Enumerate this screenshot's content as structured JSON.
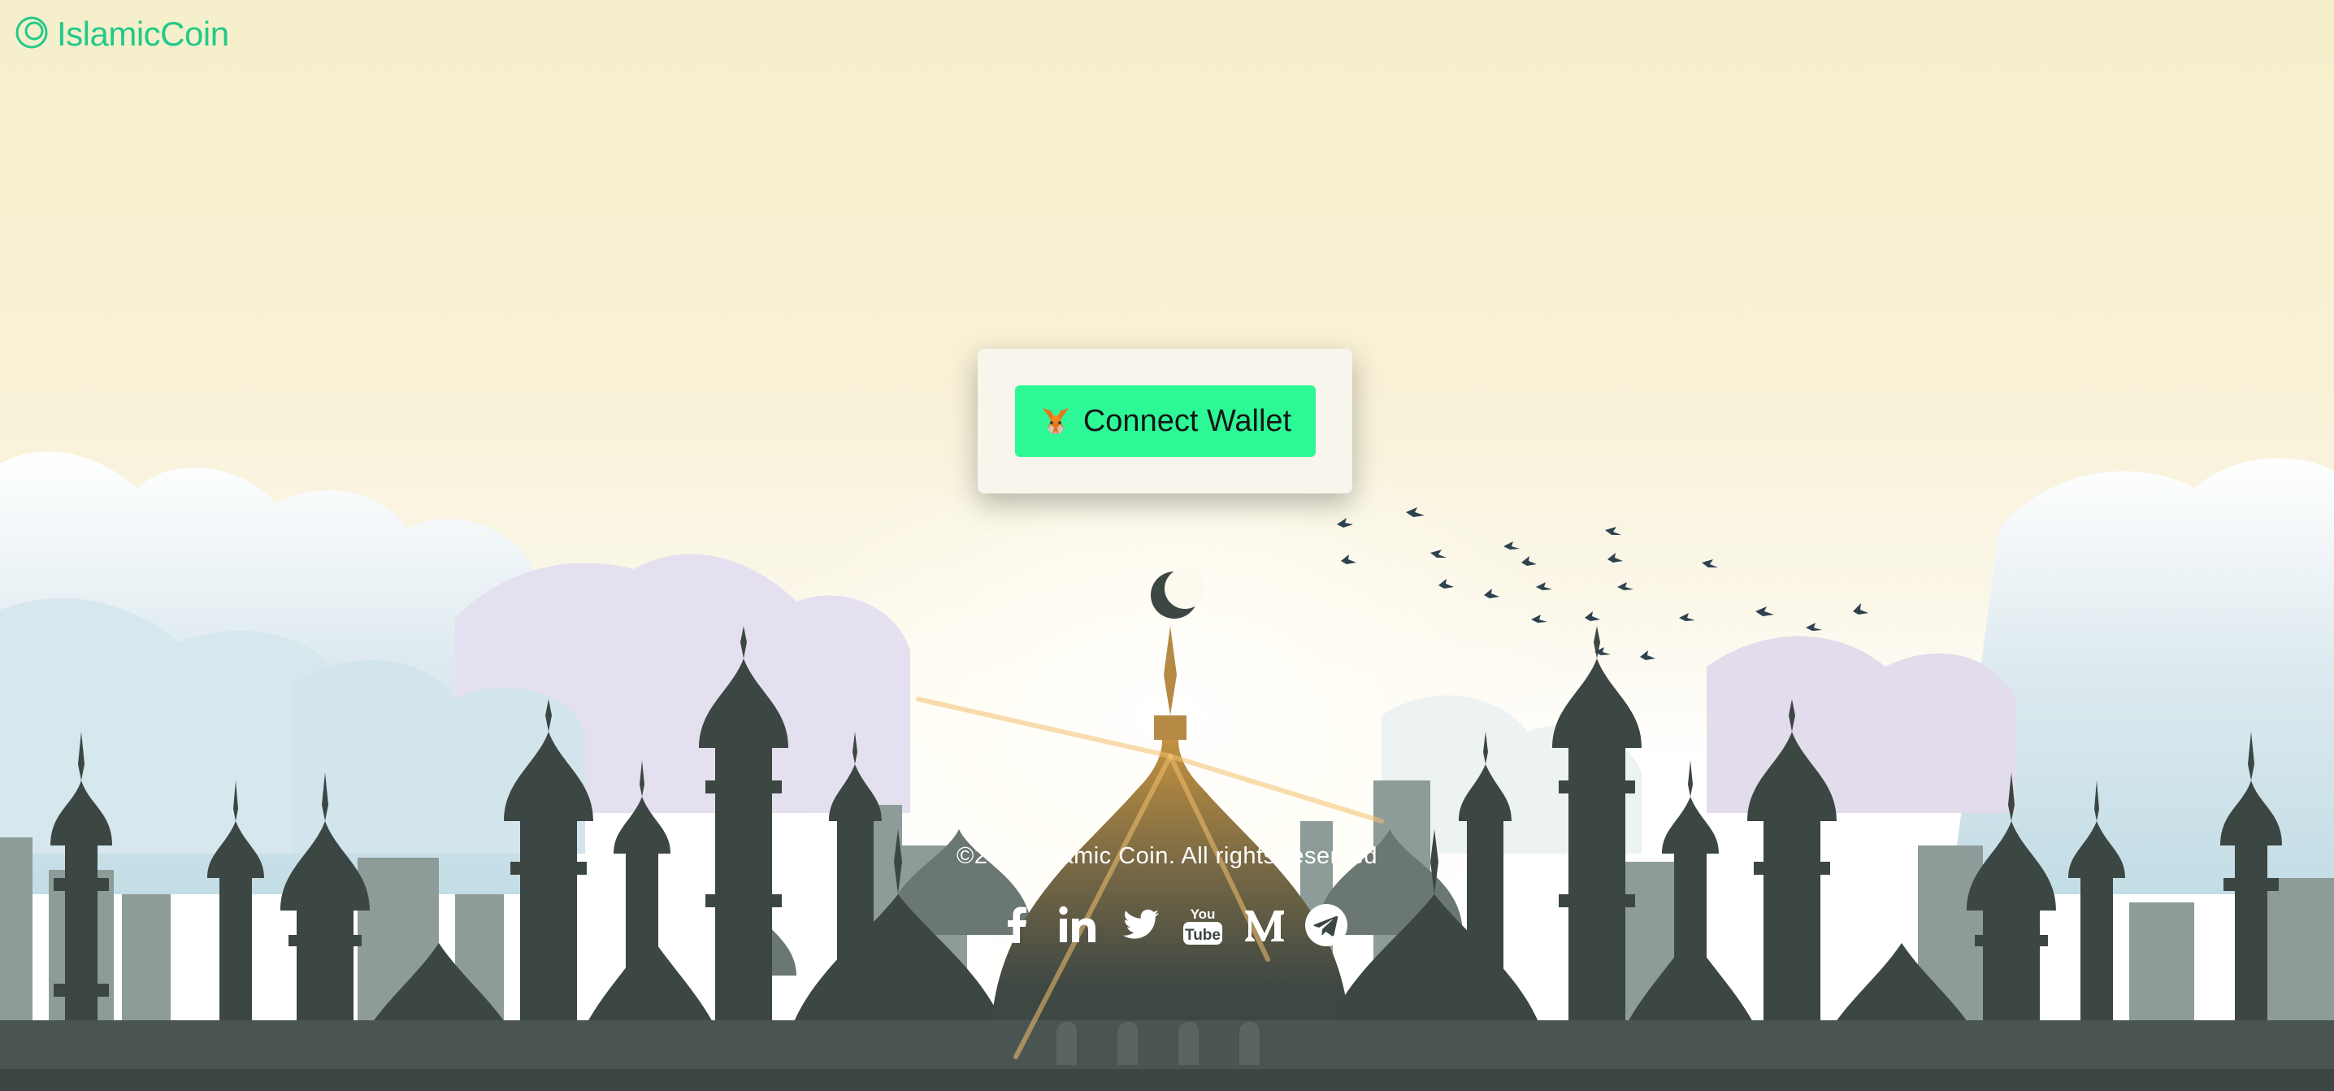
{
  "brand": {
    "name": "IslamicCoin",
    "color": "#22c98a"
  },
  "connect": {
    "label": "Connect Wallet",
    "icon": "metamask-fox-icon",
    "color": "#2cf996"
  },
  "footer": {
    "copyright": "©2022 Islamic Coin. All rights reserved"
  },
  "socials": [
    {
      "name": "facebook",
      "icon": "facebook-icon"
    },
    {
      "name": "linkedin",
      "icon": "linkedin-icon"
    },
    {
      "name": "twitter",
      "icon": "twitter-icon"
    },
    {
      "name": "youtube",
      "icon": "youtube-icon"
    },
    {
      "name": "medium",
      "icon": "medium-icon"
    },
    {
      "name": "telegram",
      "icon": "telegram-icon"
    }
  ],
  "colors": {
    "silhouette": "#3c4642",
    "skyline": "#8d9c98",
    "sky_top": "#f6efcb"
  }
}
